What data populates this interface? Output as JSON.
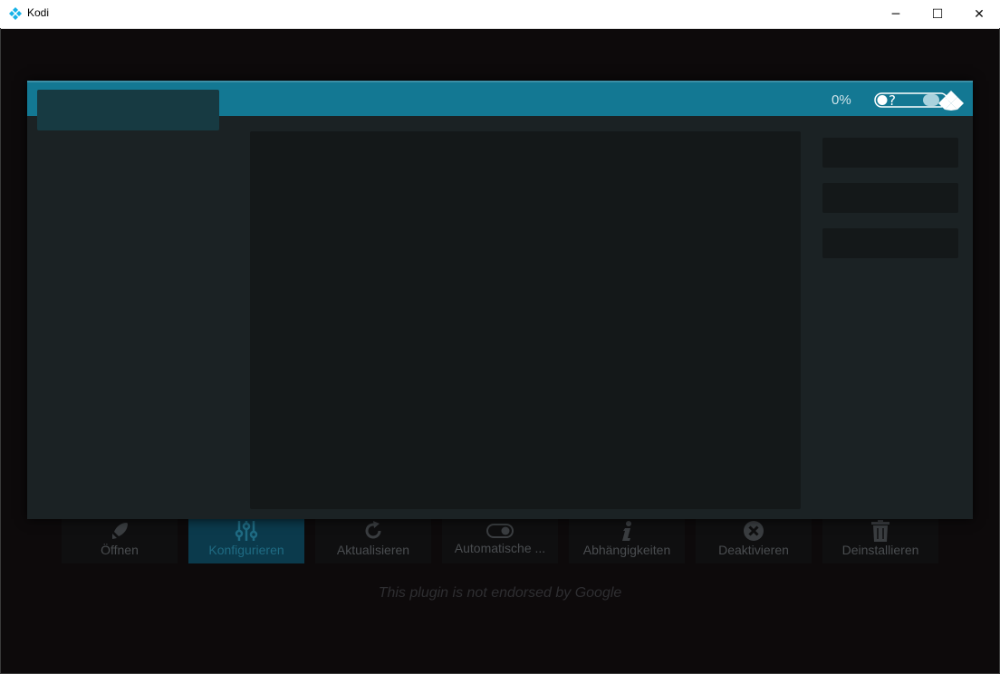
{
  "window": {
    "title": "Kodi",
    "logo_icon": "kodi-logo-icon",
    "controls": {
      "minimize": "─",
      "maximize": "☐",
      "close": "✕"
    }
  },
  "dialog": {
    "progress_label": "0%",
    "side_buttons": [
      "",
      "",
      ""
    ],
    "accent_color": "#137893"
  },
  "actions": [
    {
      "label": "Öffnen",
      "icon": "rocket-icon",
      "active": false
    },
    {
      "label": "Konfigurieren",
      "icon": "sliders-icon",
      "active": true
    },
    {
      "label": "Aktualisieren",
      "icon": "refresh-icon",
      "active": false
    },
    {
      "label": "Automatische ...",
      "icon": "toggle-icon",
      "active": false
    },
    {
      "label": "Abhängigkeiten",
      "icon": "info-icon",
      "active": false
    },
    {
      "label": "Deaktivieren",
      "icon": "close-circle-icon",
      "active": false
    },
    {
      "label": "Deinstallieren",
      "icon": "trash-icon",
      "active": false
    }
  ],
  "disclaimer": "This plugin is not endorsed by Google"
}
